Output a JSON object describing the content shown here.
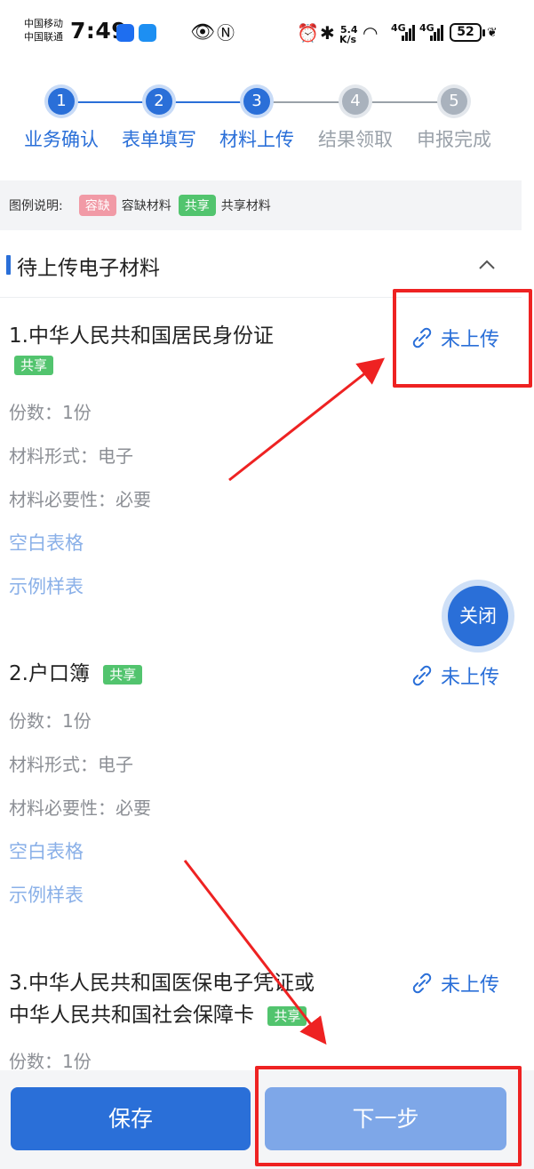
{
  "status_bar": {
    "carrier_1": "中国移动",
    "carrier_2": "中国联通",
    "time": "7:49",
    "net_speed_value": "5.4",
    "net_speed_unit": "K/s",
    "signal_1": "4G",
    "signal_2": "4G",
    "battery": "52"
  },
  "steps": [
    {
      "number": "1",
      "label": "业务确认",
      "state": "done"
    },
    {
      "number": "2",
      "label": "表单填写",
      "state": "done"
    },
    {
      "number": "3",
      "label": "材料上传",
      "state": "done"
    },
    {
      "number": "4",
      "label": "结果领取",
      "state": "todo"
    },
    {
      "number": "5",
      "label": "申报完成",
      "state": "todo"
    }
  ],
  "legend": {
    "title": "图例说明:",
    "missing_tag": "容缺",
    "missing_label": "容缺材料",
    "shared_tag": "共享",
    "shared_label": "共享材料"
  },
  "section": {
    "title": "待上传电子材料"
  },
  "materials": [
    {
      "title": "1.中华人民共和国居民身份证",
      "tag": "共享",
      "copies": "份数：1份",
      "form": "材料形式：电子",
      "necessity": "材料必要性：必要",
      "blank_form": "空白表格",
      "sample": "示例样表",
      "status": "未上传"
    },
    {
      "title": "2.户口簿",
      "tag": "共享",
      "copies": "份数：1份",
      "form": "材料形式：电子",
      "necessity": "材料必要性：必要",
      "blank_form": "空白表格",
      "sample": "示例样表",
      "status": "未上传"
    },
    {
      "title_line1": "3.中华人民共和国医保电子凭证或",
      "title_line2": "中华人民共和国社会保障卡",
      "tag": "共享",
      "copies": "份数：1份",
      "status": "未上传"
    }
  ],
  "fab": {
    "close_label": "关闭"
  },
  "bottom": {
    "save_label": "保存",
    "next_label": "下一步"
  },
  "colors": {
    "primary": "#2a6fd8",
    "primary_light": "#7ea7e8",
    "shared_green": "#52c46e",
    "missing_pink": "#f19aa6",
    "annotation_red": "#ee2222"
  }
}
